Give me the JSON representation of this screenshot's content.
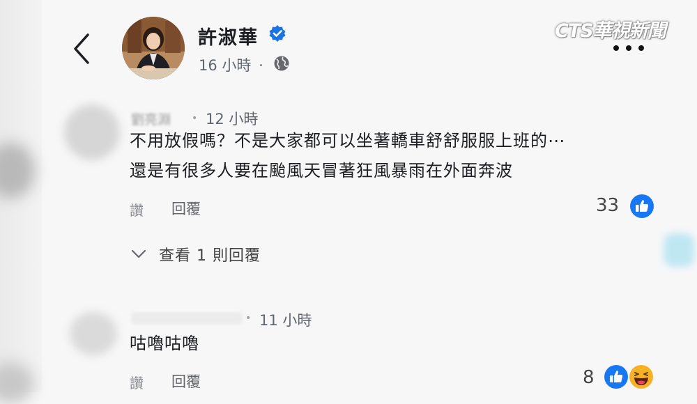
{
  "post": {
    "author": "許淑華",
    "time": "16 小時",
    "separator": "·"
  },
  "watermark": "CTS華視新聞",
  "comments": [
    {
      "author_blurred": "劉亮淵",
      "time": "12 小時",
      "text_line1": "不用放假嗎？不是大家都可以坐著轎車舒舒服服上班的⋯",
      "text_line2": "還是有很多人要在颱風天冒著狂風暴雨在外面奔波",
      "like_label": "讚",
      "reply_label": "回覆",
      "reaction_count": "33",
      "view_replies_label": "查看 1 則回覆"
    },
    {
      "author_blurred": "",
      "time": "11 小時",
      "text": "咕嚕咕嚕",
      "like_label": "讚",
      "reply_label": "回覆",
      "reaction_count": "8"
    }
  ],
  "colors": {
    "like_blue": "#1877f2",
    "verified_blue": "#1b74e4",
    "haha_yellow": "#f7b125"
  },
  "icons": [
    "back-arrow-icon",
    "verified-badge-icon",
    "globe-icon",
    "more-dots-icon",
    "chevron-down-icon",
    "like-icon",
    "haha-icon"
  ]
}
